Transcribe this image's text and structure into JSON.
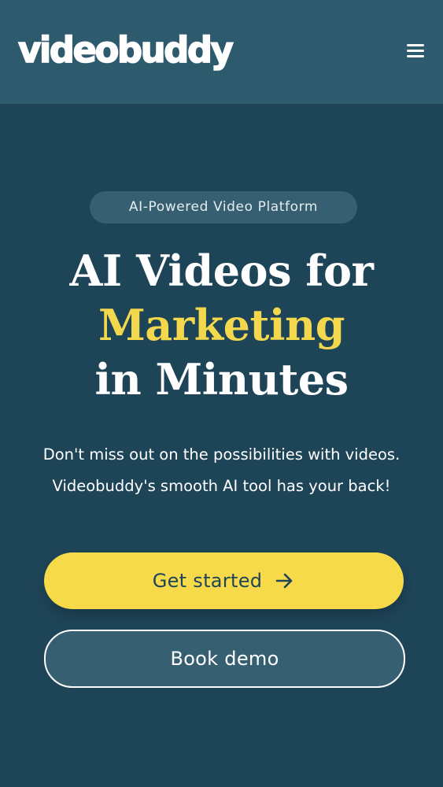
{
  "header": {
    "logo_text": "videobuddy",
    "menu_icon": "hamburger-menu-icon"
  },
  "hero": {
    "badge": "AI-Powered Video Platform",
    "headline_line1": "AI Videos for",
    "headline_accent": "Marketing",
    "headline_line3": "in Minutes",
    "subtitle_line1": "Don't miss out on the possibilities with videos.",
    "subtitle_line2": "Videobuddy's smooth AI tool has your back!",
    "primary_cta": "Get started",
    "primary_cta_icon": "arrow-right-icon",
    "secondary_cta": "Book demo"
  },
  "colors": {
    "background": "#1e4458",
    "header": "#2e5a6d",
    "accent": "#f3d84d",
    "primary_button": "#f6da4a"
  }
}
